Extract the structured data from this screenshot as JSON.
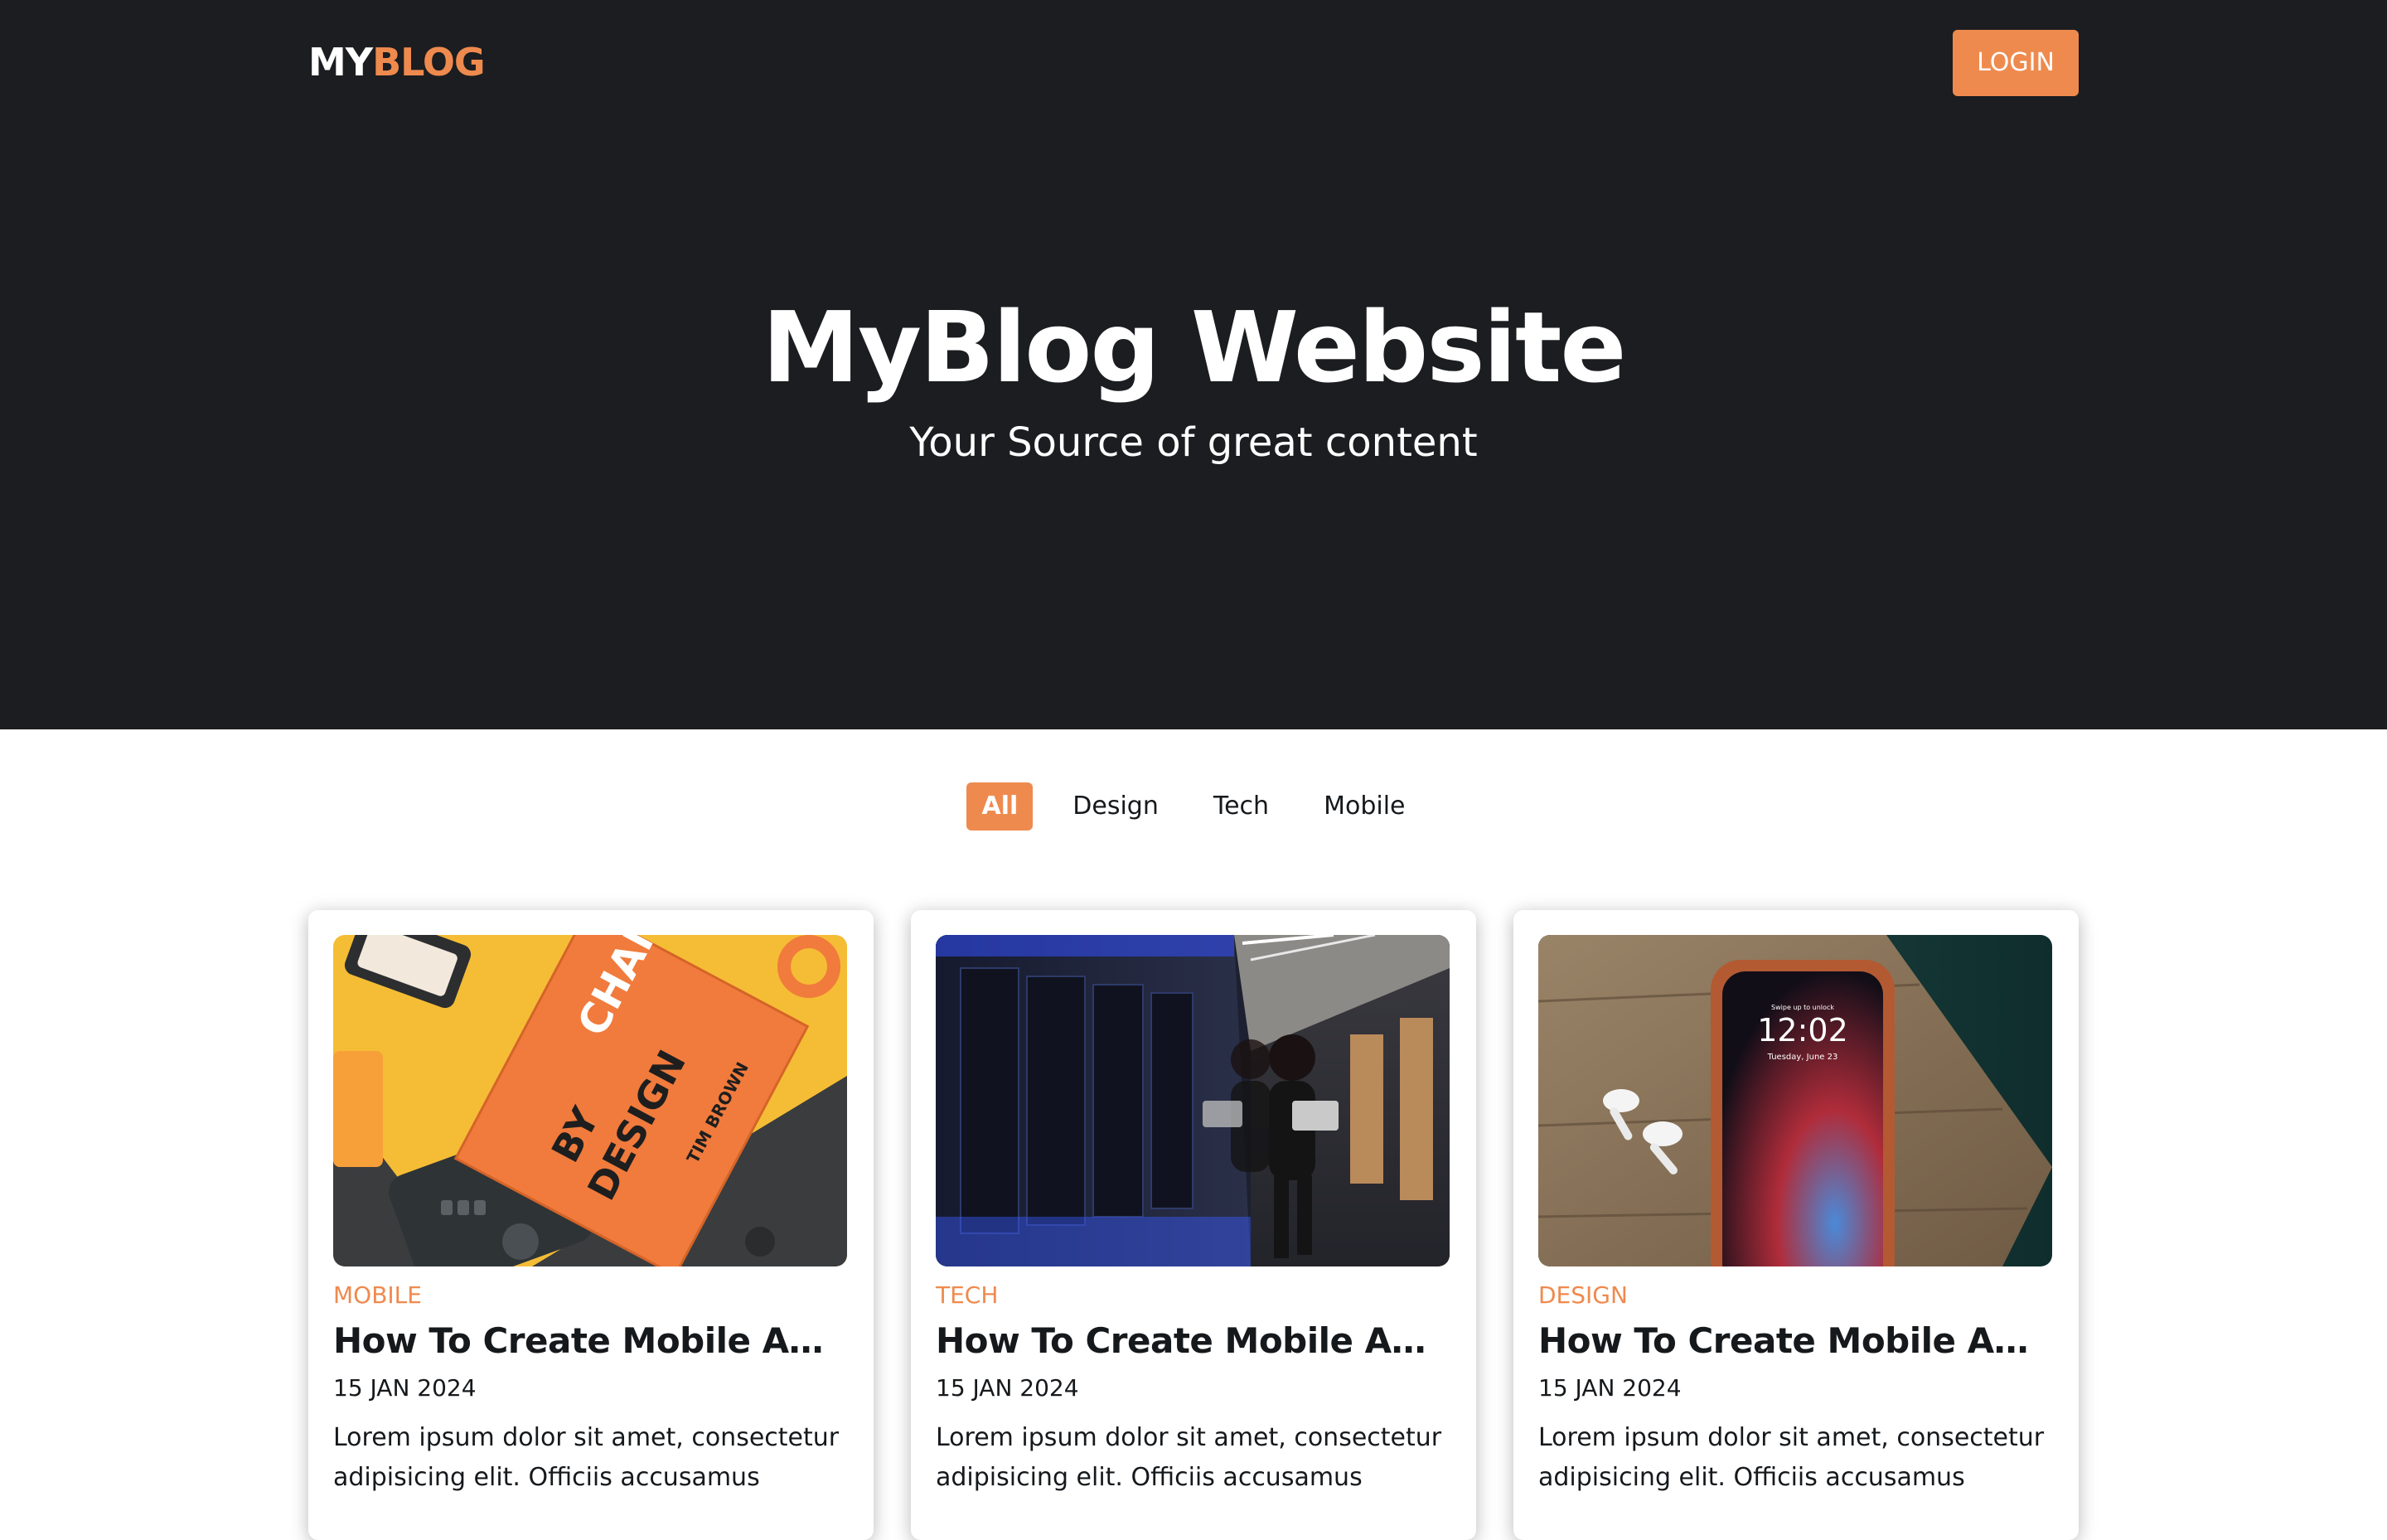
{
  "header": {
    "logo_part1": "MY",
    "logo_part2": "BLOG",
    "login_label": "LOGIN"
  },
  "hero": {
    "title": "MyBlog Website",
    "subtitle": "Your Source of great content"
  },
  "filters": [
    {
      "label": "All",
      "active": true
    },
    {
      "label": "Design",
      "active": false
    },
    {
      "label": "Tech",
      "active": false
    },
    {
      "label": "Mobile",
      "active": false
    }
  ],
  "posts": [
    {
      "category": "Mobile",
      "title": "How To Create Mobile App...",
      "date": "15 JAN 2024",
      "excerpt": "Lorem ipsum dolor sit amet, consectetur adipisicing elit. Officiis accusamus",
      "image": "book-change-by-design",
      "image_text": [
        "CHANGE",
        "BY",
        "DESIGN",
        "TIM BROWN"
      ]
    },
    {
      "category": "Tech",
      "title": "How To Create Mobile App...",
      "date": "15 JAN 2024",
      "excerpt": "Lorem ipsum dolor sit amet, consectetur adipisicing elit. Officiis accusamus",
      "image": "woman-in-server-room"
    },
    {
      "category": "Design",
      "title": "How To Create Mobile App...",
      "date": "15 JAN 2024",
      "excerpt": "Lorem ipsum dolor sit amet, consectetur adipisicing elit. Officiis accusamus",
      "image": "phone-and-earbuds",
      "image_text": [
        "12:02",
        "Tuesday, June 23",
        "Swipe up to unlock"
      ]
    }
  ],
  "colors": {
    "accent": "#ef8a4e",
    "hero_bg": "#1b1d20"
  }
}
